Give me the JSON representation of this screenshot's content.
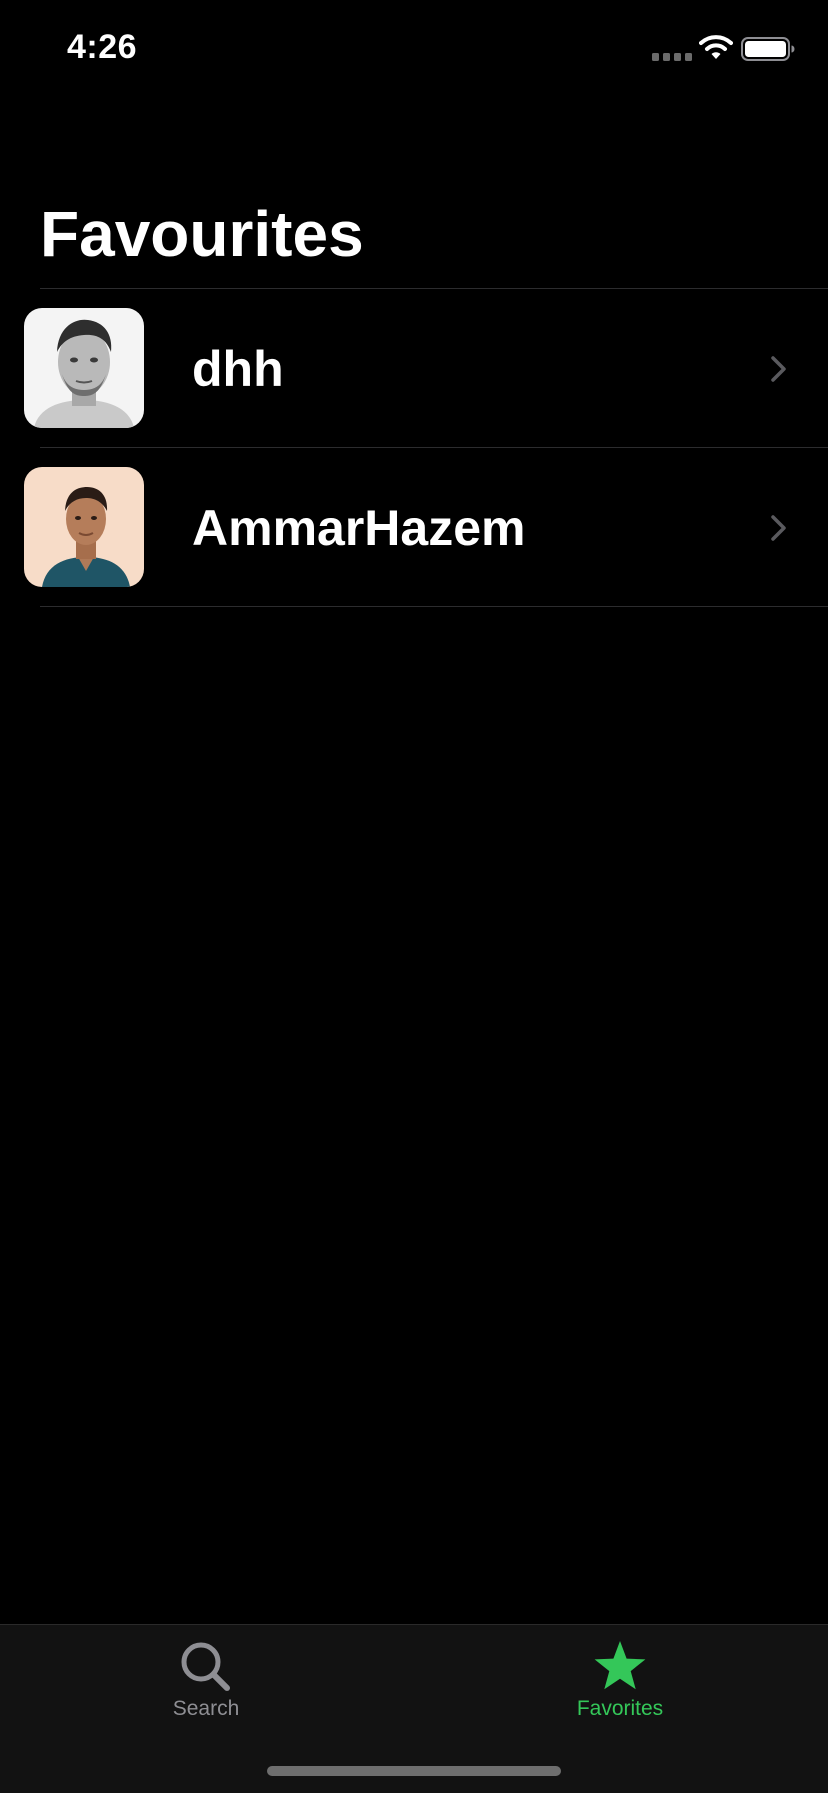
{
  "status_bar": {
    "time": "4:26",
    "icons": [
      "signal-icon",
      "wifi-icon",
      "battery-icon"
    ]
  },
  "page": {
    "title": "Favourites"
  },
  "favorites": [
    {
      "username": "dhh",
      "avatar": "avatar-photo-dhh"
    },
    {
      "username": "AmmarHazem",
      "avatar": "avatar-photo-ammarhazem"
    }
  ],
  "tab_bar": {
    "tabs": [
      {
        "label": "Search",
        "icon": "search-icon",
        "selected": false
      },
      {
        "label": "Favorites",
        "icon": "star-icon",
        "selected": true
      }
    ]
  },
  "colors": {
    "background": "#000000",
    "accent": "#34c759",
    "inactive": "#8e8e93",
    "tab_bar_background": "#121212",
    "separator": "#2c2c2e"
  }
}
